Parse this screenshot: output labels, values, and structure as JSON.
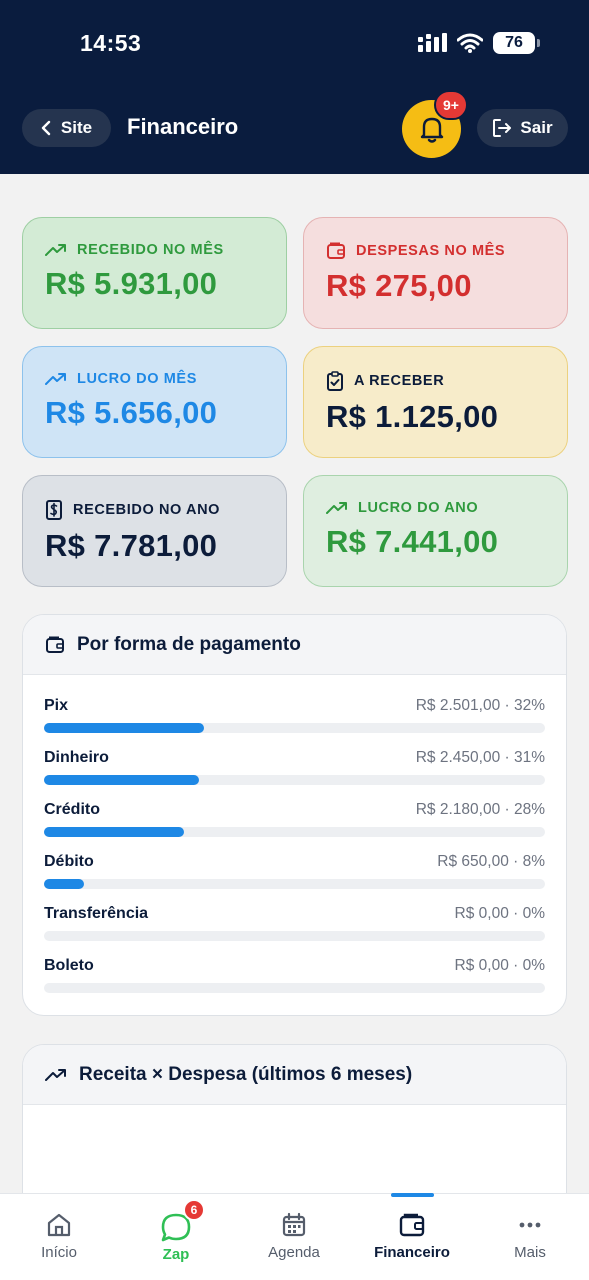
{
  "status_bar": {
    "time": "14:53",
    "battery": "76"
  },
  "header": {
    "back_label": "Site",
    "title": "Financeiro",
    "notification_badge": "9+",
    "exit_label": "Sair"
  },
  "cards": [
    {
      "label": "RECEBIDO NO MÊS",
      "value": "R$ 5.931,00",
      "icon": "trending-up-icon",
      "color": "#2f9a3e"
    },
    {
      "label": "DESPESAS NO MÊS",
      "value": "R$ 275,00",
      "icon": "wallet-icon",
      "color": "#d32f2f"
    },
    {
      "label": "LUCRO DO MÊS",
      "value": "R$ 5.656,00",
      "icon": "trending-up-icon",
      "color": "#1e88e5"
    },
    {
      "label": "A RECEBER",
      "value": "R$ 1.125,00",
      "icon": "clipboard-check-icon",
      "color": "#0c1c3a"
    },
    {
      "label": "RECEBIDO NO ANO",
      "value": "R$ 7.781,00",
      "icon": "dollar-receipt-icon",
      "color": "#0c1c3a"
    },
    {
      "label": "LUCRO DO ANO",
      "value": "R$ 7.441,00",
      "icon": "trending-up-icon",
      "color": "#2f9a3e"
    }
  ],
  "payment_panel": {
    "title": "Por forma de pagamento",
    "items": [
      {
        "label": "Pix",
        "value": "R$ 2.501,00 · 32%",
        "share": 32
      },
      {
        "label": "Dinheiro",
        "value": "R$ 2.450,00 · 31%",
        "share": 31
      },
      {
        "label": "Crédito",
        "value": "R$ 2.180,00 · 28%",
        "share": 28
      },
      {
        "label": "Débito",
        "value": "R$ 650,00 · 8%",
        "share": 8
      },
      {
        "label": "Transferência",
        "value": "R$ 0,00 · 0%",
        "share": 0
      },
      {
        "label": "Boleto",
        "value": "R$ 0,00 · 0%",
        "share": 0
      }
    ]
  },
  "revenue_panel": {
    "title": "Receita × Despesa (últimos 6 meses)"
  },
  "bottom_nav": {
    "items": [
      {
        "label": "Início",
        "icon": "home-icon"
      },
      {
        "label": "Zap",
        "icon": "chat-icon",
        "badge": "6"
      },
      {
        "label": "Agenda",
        "icon": "calendar-icon"
      },
      {
        "label": "Financeiro",
        "icon": "wallet-icon",
        "active": true
      },
      {
        "label": "Mais",
        "icon": "more-dots-icon"
      }
    ]
  },
  "colors": {
    "navy": "#0a1c3e",
    "accent_blue": "#1e88e5",
    "bell_yellow": "#f5bd14",
    "badge_red": "#e53935",
    "zap_green": "#2fbf55"
  }
}
